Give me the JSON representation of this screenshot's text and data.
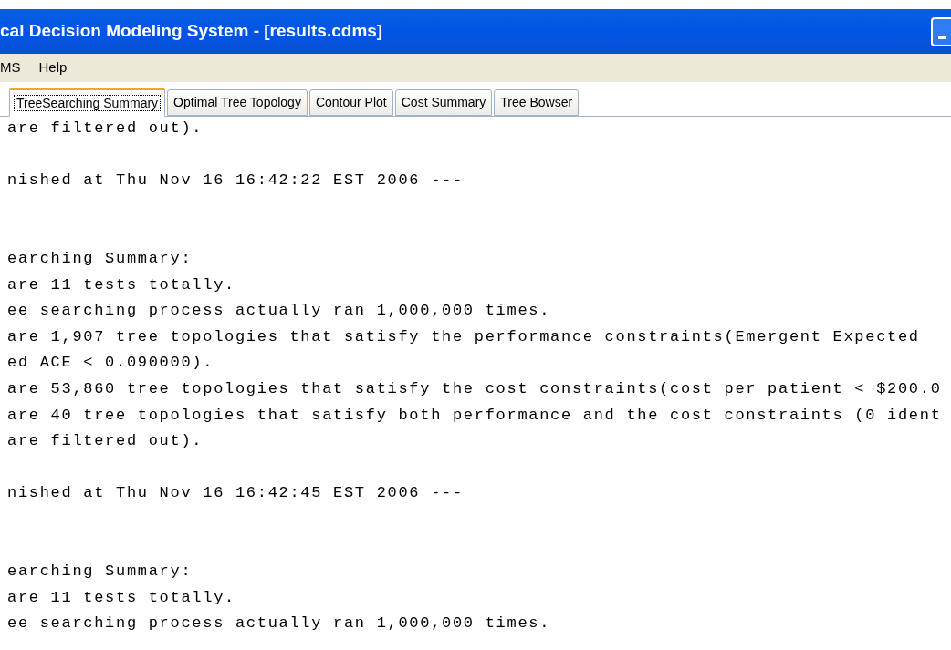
{
  "window": {
    "title": "cal Decision Modeling System - [results.cdms]"
  },
  "menu": [
    "MS",
    "Help"
  ],
  "tabs": [
    {
      "label": "TreeSearching Summary",
      "selected": true
    },
    {
      "label": "Optimal Tree Topology",
      "selected": false
    },
    {
      "label": "Contour Plot",
      "selected": false
    },
    {
      "label": "Cost Summary",
      "selected": false
    },
    {
      "label": "Tree Bowser",
      "selected": false
    }
  ],
  "log_blocks": [
    {
      "kind": "summary",
      "lines": [
        "are filtered out)."
      ]
    },
    {
      "kind": "finish",
      "lines": [
        "nished at Thu Nov 16 16:42:22 EST 2006 ---"
      ]
    },
    {
      "kind": "summary",
      "lines": [
        "earching Summary:",
        "are 11 tests totally.",
        "ee searching process actually ran 1,000,000 times.",
        "are 1,907 tree topologies that satisfy the performance constraints(Emergent Expected",
        "ed ACE < 0.090000).",
        "are 53,860 tree topologies that satisfy the cost constraints(cost per patient < $200.0",
        "are 40 tree topologies that satisfy both performance and the cost constraints (0 ident",
        "are filtered out)."
      ]
    },
    {
      "kind": "finish",
      "lines": [
        "nished at Thu Nov 16 16:42:45 EST 2006 ---"
      ]
    },
    {
      "kind": "summary",
      "lines": [
        "earching Summary:",
        "are 11 tests totally.",
        "ee searching process actually ran 1,000,000 times."
      ]
    }
  ]
}
